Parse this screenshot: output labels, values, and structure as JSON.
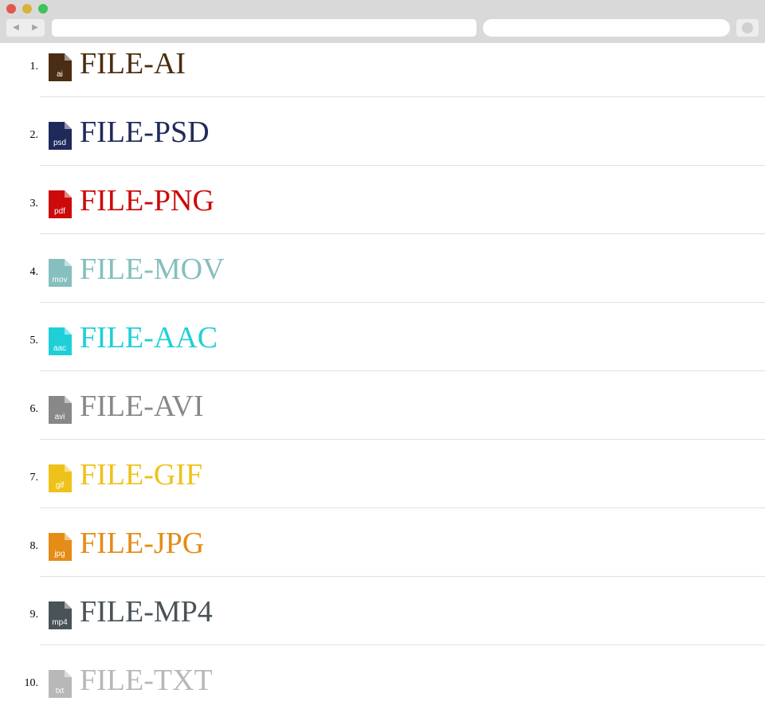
{
  "browser": {
    "back_icon": "back-arrow-icon",
    "forward_icon": "forward-arrow-icon",
    "address_value": "",
    "search_value": ""
  },
  "files": [
    {
      "number": "1.",
      "label": "FILE-AI",
      "ext": "ai",
      "color": "#4a2d12"
    },
    {
      "number": "2.",
      "label": "FILE-PSD",
      "ext": "psd",
      "color": "#1f2a5a"
    },
    {
      "number": "3.",
      "label": "FILE-PNG",
      "ext": "pdf",
      "color": "#cc0a0a"
    },
    {
      "number": "4.",
      "label": "FILE-MOV",
      "ext": "mov",
      "color": "#85bfbf"
    },
    {
      "number": "5.",
      "label": "FILE-AAC",
      "ext": "aac",
      "color": "#1fcfd7"
    },
    {
      "number": "6.",
      "label": "FILE-AVI",
      "ext": "avi",
      "color": "#888888"
    },
    {
      "number": "7.",
      "label": "FILE-GIF",
      "ext": "gif",
      "color": "#eec21a"
    },
    {
      "number": "8.",
      "label": "FILE-JPG",
      "ext": "jpg",
      "color": "#e48c15"
    },
    {
      "number": "9.",
      "label": "FILE-MP4",
      "ext": "mp4",
      "color": "#4a5358"
    },
    {
      "number": "10.",
      "label": "FILE-TXT",
      "ext": "txt",
      "color": "#b8b8b8"
    }
  ]
}
